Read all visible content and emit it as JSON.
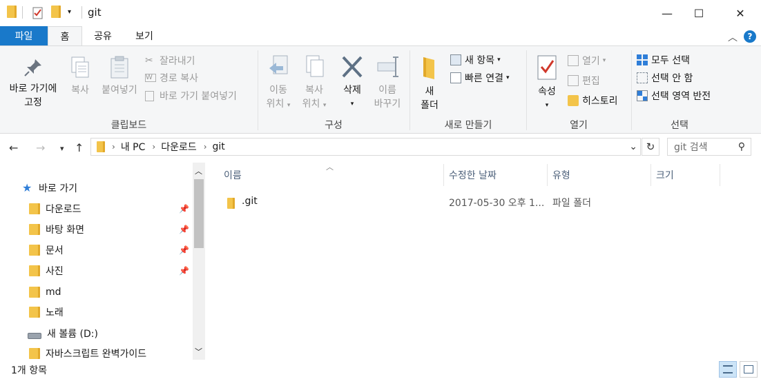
{
  "window": {
    "title": "git",
    "qa_dropdown_icon": "down-caret-icon",
    "controls": [
      "—",
      "☐",
      "✕"
    ]
  },
  "tabs": [
    "파일",
    "홈",
    "공유",
    "보기"
  ],
  "ribbon": {
    "clipboard": {
      "group": "클립보드",
      "pin_line1": "바로 가기에",
      "pin_line2": "고정",
      "copy": "복사",
      "paste": "붙여넣기",
      "cut": "잘라내기",
      "copy_path": "경로 복사",
      "paste_shortcut": "바로 가기 붙여넣기"
    },
    "organize": {
      "group": "구성",
      "move_line1": "이동",
      "move_line2": "위치",
      "copy_line1": "복사",
      "copy_line2": "위치",
      "delete": "삭제",
      "rename_line1": "이름",
      "rename_line2": "바꾸기"
    },
    "new": {
      "group": "새로 만들기",
      "folder_line1": "새",
      "folder_line2": "폴더",
      "new_item": "새 항목",
      "easy_access": "빠른 연결"
    },
    "open": {
      "group": "열기",
      "properties": "속성",
      "open": "열기",
      "edit": "편집",
      "history": "히스토리"
    },
    "select": {
      "group": "선택",
      "select_all": "모두 선택",
      "select_none": "선택 안 함",
      "invert": "선택 영역 반전"
    }
  },
  "address": {
    "crumbs": [
      "내 PC",
      "다운로드",
      "git"
    ],
    "search_placeholder": "git 검색"
  },
  "nav_pane": {
    "quick_access": "바로 가기",
    "items": [
      {
        "label": "다운로드",
        "pinned": true
      },
      {
        "label": "바탕 화면",
        "pinned": true
      },
      {
        "label": "문서",
        "pinned": true
      },
      {
        "label": "사진",
        "pinned": true
      },
      {
        "label": "md",
        "pinned": false
      },
      {
        "label": "노래",
        "pinned": false
      },
      {
        "label": "새 볼륨 (D:)",
        "pinned": false
      },
      {
        "label": "자바스크립트 완벽가이드",
        "pinned": false
      }
    ]
  },
  "columns": {
    "name": "이름",
    "modified": "수정한 날짜",
    "type": "유형",
    "size": "크기"
  },
  "files": [
    {
      "name": ".git",
      "modified": "2017-05-30 오후 1...",
      "type": "파일 폴더",
      "size": ""
    }
  ],
  "status": {
    "count": "1개 항목"
  },
  "colors": {
    "accent": "#1979ca",
    "folder": "#f3c44a",
    "header_text": "#4c607a"
  }
}
